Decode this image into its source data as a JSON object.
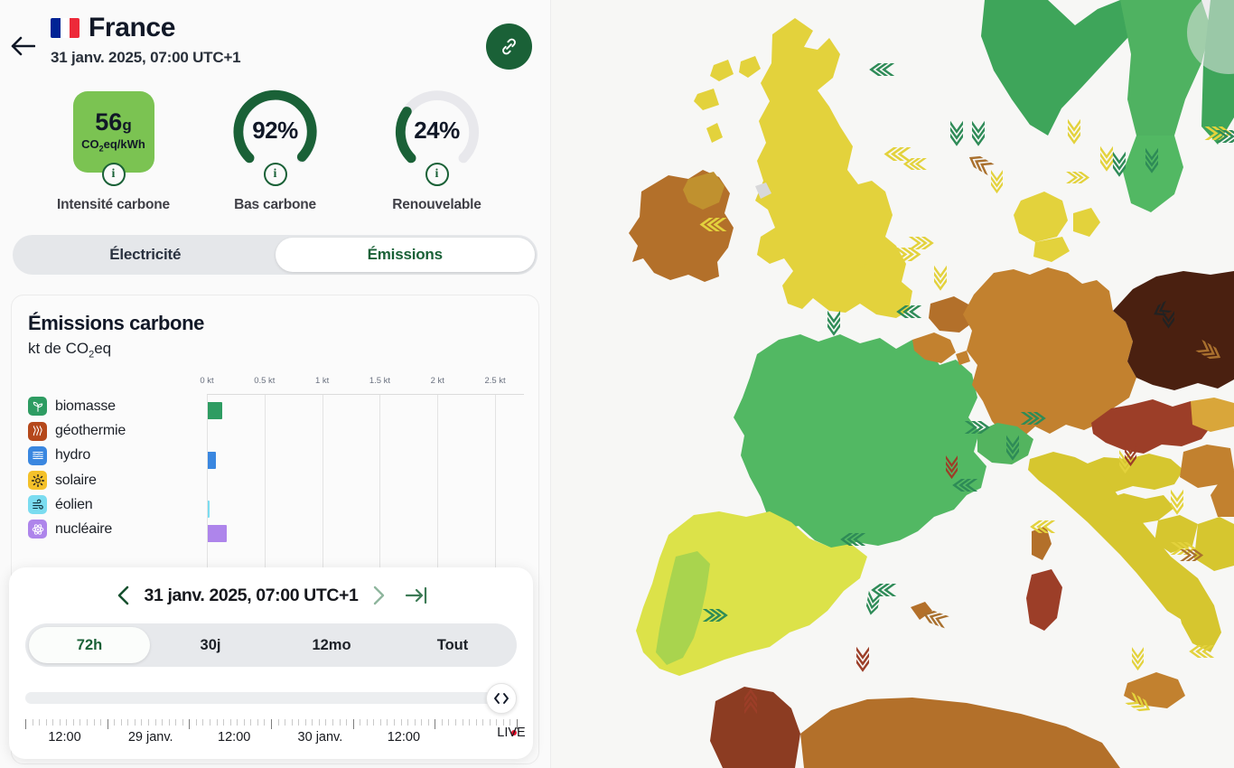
{
  "header": {
    "back_icon": "arrow-left-icon",
    "flag_icon": "france-flag-icon",
    "zone_name": "France",
    "datetime": "31 janv. 2025, 07:00 UTC+1",
    "share_icon": "link-icon"
  },
  "gauges": [
    {
      "id": "carbon-intensity",
      "kind": "square",
      "value": "56",
      "value_unit": "g",
      "unit_line": "CO2eq/kWh",
      "label": "Intensité carbone",
      "color": "#7BC352",
      "info_icon": "info-icon"
    },
    {
      "id": "low-carbon",
      "kind": "arc",
      "value": "92%",
      "percent": 92,
      "label": "Bas carbone",
      "color": "#1A6137",
      "info_icon": "info-icon"
    },
    {
      "id": "renewable",
      "kind": "arc",
      "value": "24%",
      "percent": 24,
      "label": "Renouvelable",
      "color": "#1A6137",
      "info_icon": "info-icon"
    }
  ],
  "tabs": [
    {
      "id": "electricity",
      "label": "Électricité",
      "active": false
    },
    {
      "id": "emissions",
      "label": "Émissions",
      "active": true
    }
  ],
  "card": {
    "title": "Émissions carbone",
    "subtitle_pre": "kt de CO",
    "subtitle_sub": "2",
    "subtitle_post": "eq"
  },
  "chart_data": {
    "type": "bar",
    "title": "Émissions carbone",
    "xlabel": "kt de CO2eq",
    "ylabel": "",
    "xlim": [
      0,
      2.75
    ],
    "orientation": "horizontal",
    "grid": true,
    "legend": "left-labels",
    "tick_labels": [
      "0 kt",
      "0.5 kt",
      "1 kt",
      "1.5 kt",
      "2 kt",
      "2.5 kt"
    ],
    "tick_values": [
      0,
      0.5,
      1,
      1.5,
      2,
      2.5
    ],
    "categories": [
      "biomasse",
      "géothermie",
      "hydro",
      "solaire",
      "éolien",
      "nucléaire"
    ],
    "values": [
      0.13,
      0,
      0.082,
      0,
      0.027,
      0.175
    ],
    "colors": [
      "#2E9C62",
      "#B5481B",
      "#3A87E0",
      "#F4C12A",
      "#7BDCF0",
      "#AE85EB"
    ],
    "icons": [
      "biomass-icon",
      "geothermal-icon",
      "hydro-icon",
      "solar-icon",
      "wind-icon",
      "nuclear-icon"
    ]
  },
  "time_controller": {
    "prev_icon": "chevron-left-icon",
    "next_icon": "chevron-right-icon",
    "to_latest_icon": "arrow-to-end-icon",
    "datetime": "31 janv. 2025, 07:00 UTC+1",
    "ranges": [
      {
        "id": "72h",
        "label": "72h",
        "active": true
      },
      {
        "id": "30d",
        "label": "30j",
        "active": false
      },
      {
        "id": "12mo",
        "label": "12mo",
        "active": false
      },
      {
        "id": "all",
        "label": "Tout",
        "active": false
      }
    ],
    "slider": {
      "handle_icon": "drag-handle-icon",
      "position_percent": 100
    },
    "axis_labels": [
      {
        "text": "12:00",
        "pos": 8
      },
      {
        "text": "29 janv.",
        "pos": 25.5
      },
      {
        "text": "12:00",
        "pos": 42.5
      },
      {
        "text": "30 janv.",
        "pos": 60
      },
      {
        "text": "12:00",
        "pos": 77
      }
    ],
    "live_label": "LIVE"
  },
  "map": {
    "background": "#f7f7f5",
    "palette": {
      "very_low": "#3EA55A",
      "low": "#51B95F",
      "low2": "#82CC52",
      "mid_low": "#C8DE46",
      "mid": "#E3D23C",
      "mid2": "#D6C62F",
      "mid_high": "#D9A63A",
      "high": "#C2812F",
      "higher": "#B3702A",
      "very_high": "#A8562C",
      "extreme": "#8C3C22",
      "max": "#4A2010"
    },
    "arrow_icon": "exchange-arrow-icon"
  }
}
